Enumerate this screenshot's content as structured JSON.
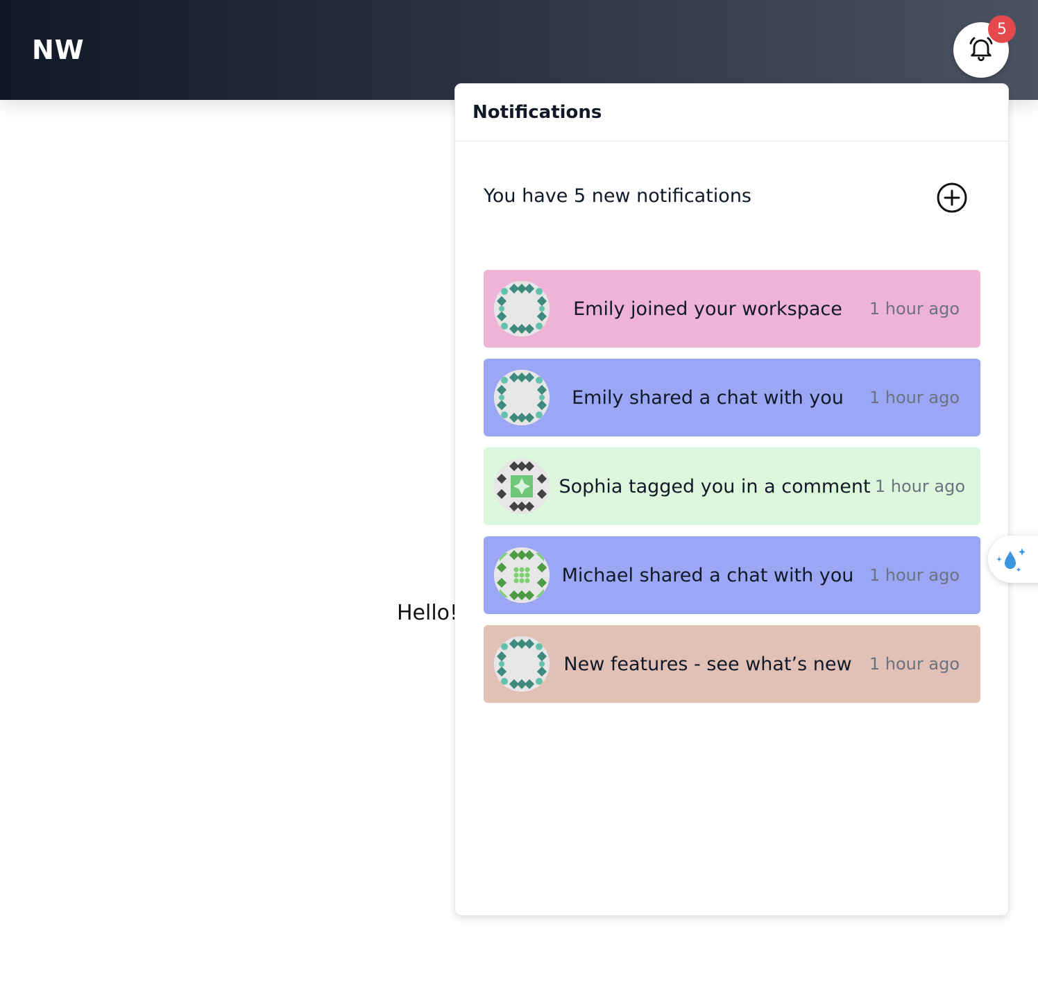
{
  "header": {
    "logo": "NW",
    "bell_icon": "bell-icon",
    "badge_count": "5"
  },
  "main": {
    "greeting": "Hello!"
  },
  "panel": {
    "title": "Notifications",
    "summary": "You have 5 new notifications",
    "add_icon": "plus-circle-icon",
    "items": [
      {
        "text": "Emily joined your workspace",
        "time": "1 hour ago",
        "color": "#efb3d6",
        "avatar": "teal-pattern"
      },
      {
        "text": "Emily shared a chat with you",
        "time": "1 hour ago",
        "color": "#9ba7f5",
        "avatar": "teal-pattern"
      },
      {
        "text": "Sophia tagged you in a comment",
        "time": "1 hour ago",
        "color": "#dcf7dc",
        "avatar": "dark-green-pattern"
      },
      {
        "text": "Michael shared a chat with you",
        "time": "1 hour ago",
        "color": "#9ba7f5",
        "avatar": "green-pattern"
      },
      {
        "text": "New features - see what’s new",
        "time": "1 hour ago",
        "color": "#e1c0b6",
        "avatar": "teal-pattern"
      }
    ]
  },
  "side_widget": {
    "icon": "droplet-sparkle-icon"
  },
  "colors": {
    "header_start": "#111827",
    "header_end": "#4b5262",
    "badge": "#e5484d"
  }
}
